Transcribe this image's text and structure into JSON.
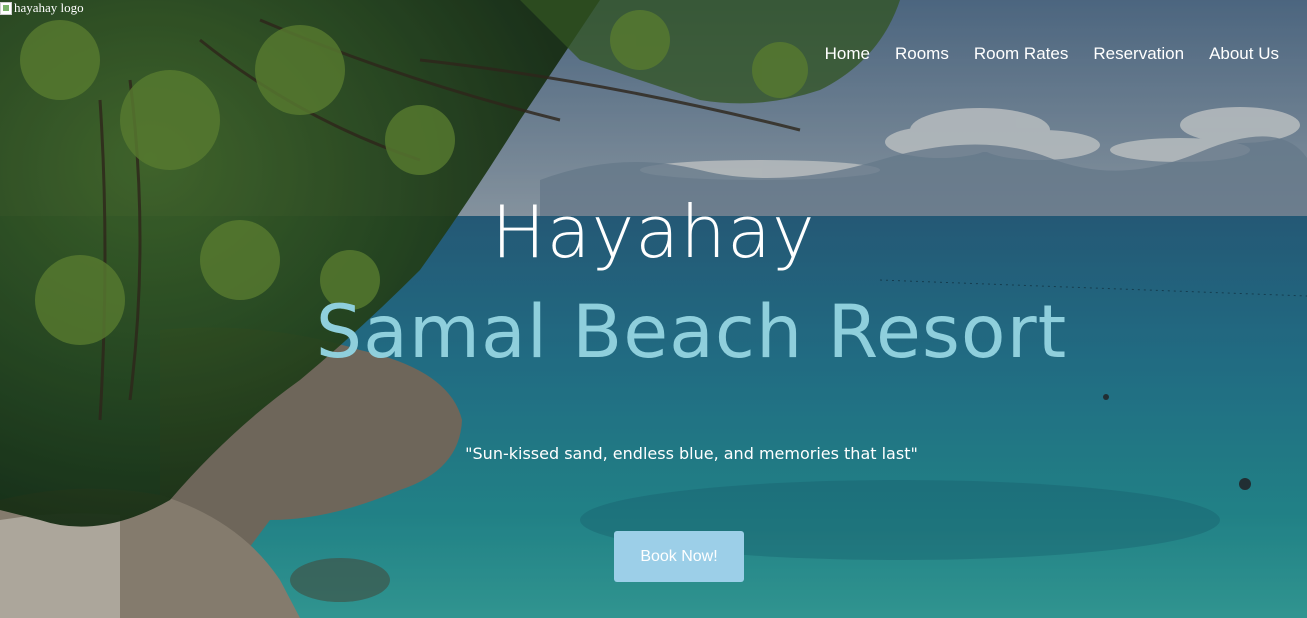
{
  "logo": {
    "alt_text": "hayahay logo"
  },
  "nav": {
    "items": [
      {
        "label": "Home"
      },
      {
        "label": "Rooms"
      },
      {
        "label": "Room Rates"
      },
      {
        "label": "Reservation"
      },
      {
        "label": "About Us"
      }
    ]
  },
  "hero": {
    "title": "Hayahay",
    "subtitle": "Samal Beach Resort",
    "tagline": "\"Sun-kissed sand, endless blue, and memories that last\"",
    "cta_label": "Book Now!"
  },
  "colors": {
    "subtitle": "#8fcfdc",
    "button": "#9ccfe8",
    "sky": "#6c8fae",
    "sea": "#1f8aa0"
  }
}
